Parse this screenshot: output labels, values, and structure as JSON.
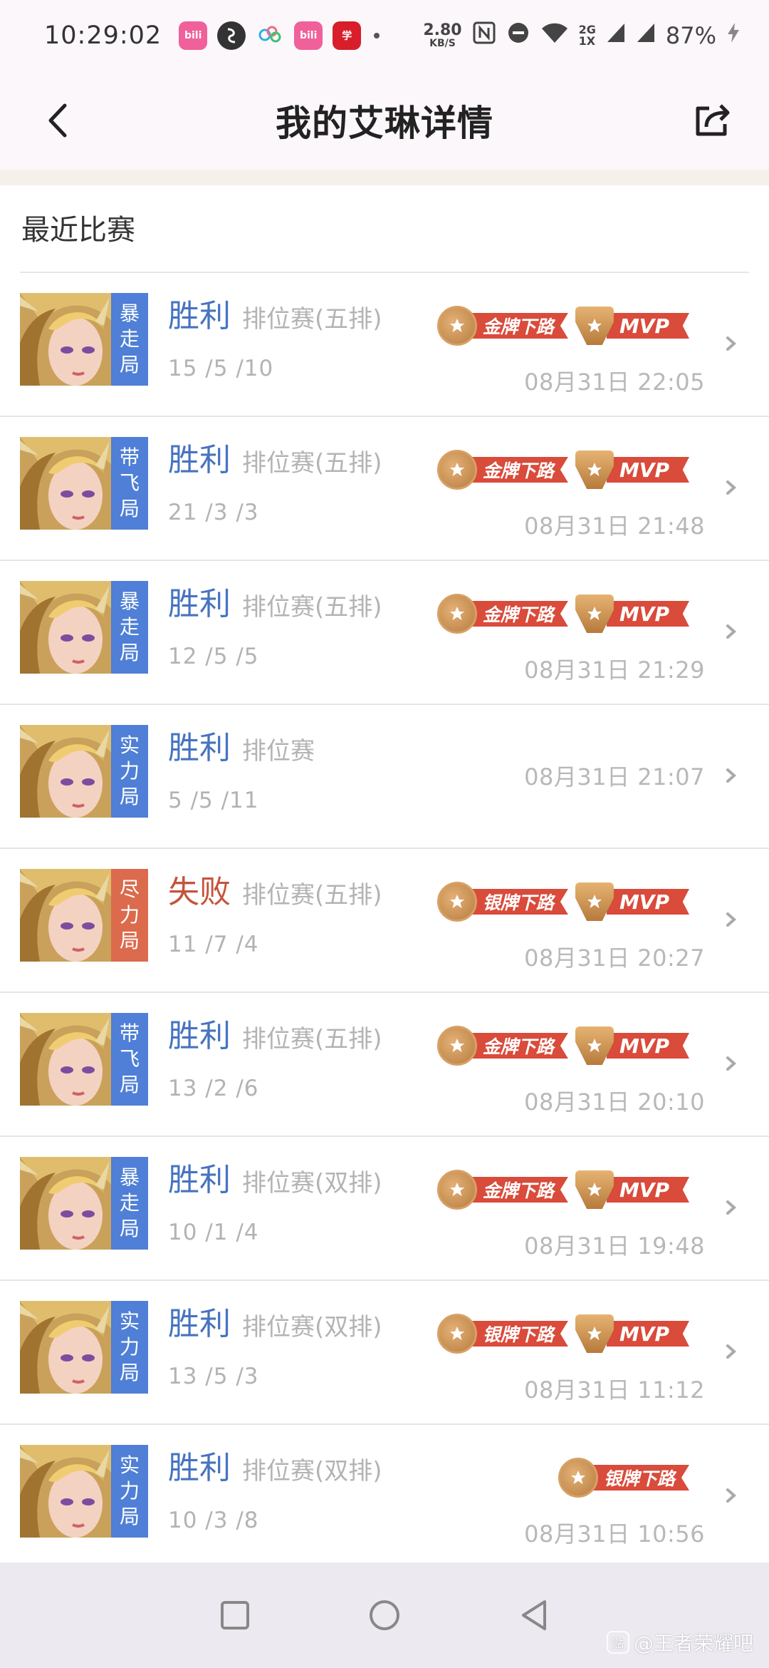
{
  "status_bar": {
    "time": "10:29:02",
    "net_speed_value": "2.80",
    "net_speed_unit": "KB/S",
    "signal_label_top": "2G",
    "signal_label_bottom": "1X",
    "battery": "87%",
    "apps": [
      {
        "name": "bilibili",
        "label": "bilibili"
      },
      {
        "name": "app-circle",
        "label": ""
      },
      {
        "name": "app-cloud",
        "label": ""
      },
      {
        "name": "bilibili-2",
        "label": "bilibili"
      },
      {
        "name": "app-red",
        "label": "学习"
      }
    ]
  },
  "header": {
    "title": "我的艾琳详情"
  },
  "section": {
    "title": "最近比赛"
  },
  "matches": [
    {
      "tag": [
        "暴",
        "走",
        "局"
      ],
      "tag_color": "#4f7fd6",
      "result": "胜利",
      "win": true,
      "mode": "排位赛(五排)",
      "kda": "15 /5 /10",
      "badges": [
        {
          "type": "medal",
          "label": "金牌下路"
        },
        {
          "type": "mvp",
          "label": "MVP"
        }
      ],
      "time": "08月31日 22:05"
    },
    {
      "tag": [
        "带",
        "飞",
        "局"
      ],
      "tag_color": "#4f7fd6",
      "result": "胜利",
      "win": true,
      "mode": "排位赛(五排)",
      "kda": "21 /3 /3",
      "badges": [
        {
          "type": "medal",
          "label": "金牌下路"
        },
        {
          "type": "mvp",
          "label": "MVP"
        }
      ],
      "time": "08月31日 21:48"
    },
    {
      "tag": [
        "暴",
        "走",
        "局"
      ],
      "tag_color": "#4f7fd6",
      "result": "胜利",
      "win": true,
      "mode": "排位赛(五排)",
      "kda": "12 /5 /5",
      "badges": [
        {
          "type": "medal",
          "label": "金牌下路"
        },
        {
          "type": "mvp",
          "label": "MVP"
        }
      ],
      "time": "08月31日 21:29"
    },
    {
      "tag": [
        "实",
        "力",
        "局"
      ],
      "tag_color": "#4f7fd6",
      "result": "胜利",
      "win": true,
      "mode": "排位赛",
      "kda": "5 /5 /11",
      "badges": [],
      "time": "08月31日 21:07"
    },
    {
      "tag": [
        "尽",
        "力",
        "局"
      ],
      "tag_color": "#dc6a4c",
      "result": "失败",
      "win": false,
      "mode": "排位赛(五排)",
      "kda": "11 /7 /4",
      "badges": [
        {
          "type": "medal",
          "label": "银牌下路"
        },
        {
          "type": "mvp",
          "label": "MVP"
        }
      ],
      "time": "08月31日 20:27"
    },
    {
      "tag": [
        "带",
        "飞",
        "局"
      ],
      "tag_color": "#4f7fd6",
      "result": "胜利",
      "win": true,
      "mode": "排位赛(五排)",
      "kda": "13 /2 /6",
      "badges": [
        {
          "type": "medal",
          "label": "金牌下路"
        },
        {
          "type": "mvp",
          "label": "MVP"
        }
      ],
      "time": "08月31日 20:10"
    },
    {
      "tag": [
        "暴",
        "走",
        "局"
      ],
      "tag_color": "#4f7fd6",
      "result": "胜利",
      "win": true,
      "mode": "排位赛(双排)",
      "kda": "10 /1 /4",
      "badges": [
        {
          "type": "medal",
          "label": "金牌下路"
        },
        {
          "type": "mvp",
          "label": "MVP"
        }
      ],
      "time": "08月31日 19:48"
    },
    {
      "tag": [
        "实",
        "力",
        "局"
      ],
      "tag_color": "#4f7fd6",
      "result": "胜利",
      "win": true,
      "mode": "排位赛(双排)",
      "kda": "13 /5 /3",
      "badges": [
        {
          "type": "medal",
          "label": "银牌下路"
        },
        {
          "type": "mvp",
          "label": "MVP"
        }
      ],
      "time": "08月31日 11:12"
    },
    {
      "tag": [
        "实",
        "力",
        "局"
      ],
      "tag_color": "#4f7fd6",
      "result": "胜利",
      "win": true,
      "mode": "排位赛(双排)",
      "kda": "10 /3 /8",
      "badges": [
        {
          "type": "medal",
          "label": "银牌下路"
        }
      ],
      "time": "08月31日 10:56"
    }
  ],
  "watermark": {
    "text": "@王者荣耀吧"
  },
  "colors": {
    "win": "#4673c2",
    "lose": "#c4533b",
    "badge_ribbon": "#d94b3a"
  }
}
